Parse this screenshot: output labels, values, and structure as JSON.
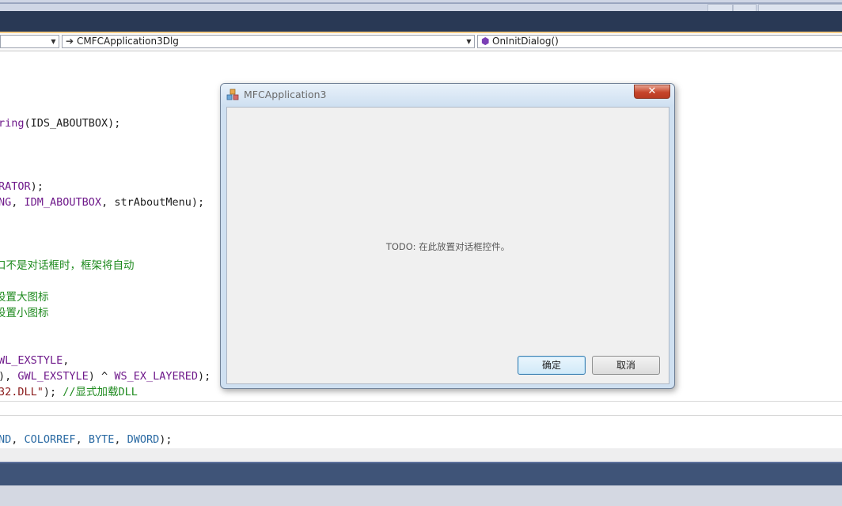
{
  "navbar": {
    "scope_value": "",
    "class_value": "CMFCApplication3Dlg",
    "member_value": "OnInitDialog()"
  },
  "code": {
    "line1": {
      "purple": "ring",
      "dark": "(IDS_ABOUTBOX);"
    },
    "line2": {
      "purple": "RATOR",
      "dark": ");"
    },
    "line3": {
      "purple1": "NG",
      "dark1": ", ",
      "purple2": "IDM_ABOUTBOX",
      "dark2": ", strAboutMenu);"
    },
    "line4": "口不是对话框时，框架将自动",
    "line5": "设置大图标",
    "line6": "设置小图标",
    "line7": {
      "purple": "WL_EXSTYLE",
      "dark": ","
    },
    "line8": {
      "dark1": "), ",
      "purple1": "GWL_EXSTYLE",
      "dark2": ") ^ ",
      "purple2": "WS_EX_LAYERED",
      "dark3": ");"
    },
    "line9": {
      "brown": "32.DLL\"",
      "dark": "); ",
      "green": "//显式加载DLL"
    },
    "line10": {
      "blue1": "ND",
      "dark1": ", ",
      "blue2": "COLORREF",
      "dark2": ", ",
      "blue3": "BYTE",
      "dark3": ", ",
      "blue4": "DWORD",
      "dark4": ");"
    }
  },
  "dialog": {
    "title": "MFCApplication3",
    "close_glyph": "✕",
    "todo_text": "TODO:  在此放置对话框控件。",
    "ok_label": "确定",
    "cancel_label": "取消"
  },
  "colors": {
    "title_band": "#293955",
    "status_band": "#3f5478",
    "accent_yellow": "#f5cc84"
  }
}
